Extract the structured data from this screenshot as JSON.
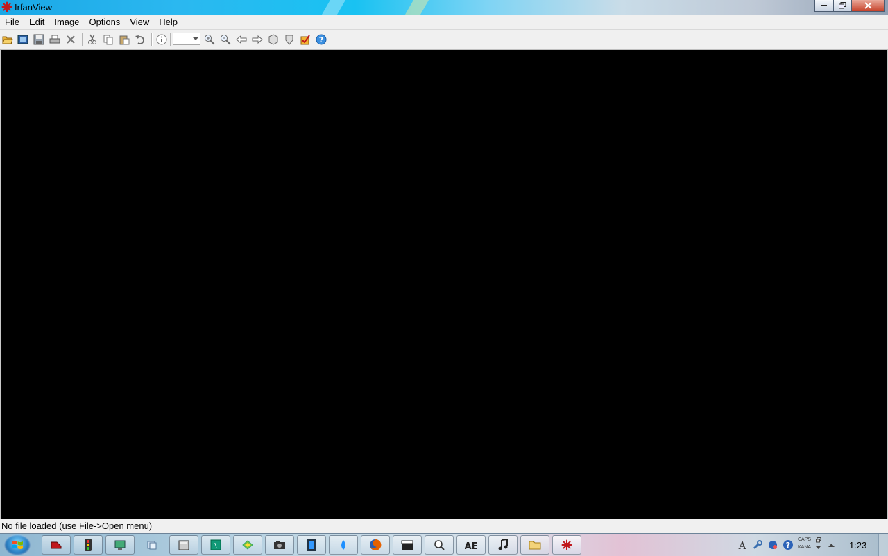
{
  "window": {
    "title": "IrfanView",
    "controls": [
      "minimize",
      "maximize",
      "close"
    ]
  },
  "menu": {
    "items": [
      "File",
      "Edit",
      "Image",
      "Options",
      "View",
      "Help"
    ]
  },
  "toolbar": {
    "zoom_value": "",
    "buttons": [
      {
        "name": "open-icon"
      },
      {
        "name": "slideshow-icon"
      },
      {
        "name": "save-icon"
      },
      {
        "name": "print-icon"
      },
      {
        "name": "delete-icon"
      },
      {
        "name": "cut-icon"
      },
      {
        "name": "copy-icon"
      },
      {
        "name": "paste-icon"
      },
      {
        "name": "undo-icon"
      },
      {
        "name": "info-icon"
      },
      {
        "name": "zoom-in-icon"
      },
      {
        "name": "zoom-out-icon"
      },
      {
        "name": "previous-icon"
      },
      {
        "name": "next-icon"
      },
      {
        "name": "first-icon"
      },
      {
        "name": "last-icon"
      },
      {
        "name": "thumbnails-icon"
      },
      {
        "name": "help-icon"
      }
    ]
  },
  "status": {
    "text": "No file loaded (use File->Open menu)"
  },
  "taskbar": {
    "caps": "CAPS",
    "kana": "KANA",
    "clock": "1:23",
    "colors": {
      "accent": "#1aa7e6",
      "close": "#c7432b"
    }
  }
}
